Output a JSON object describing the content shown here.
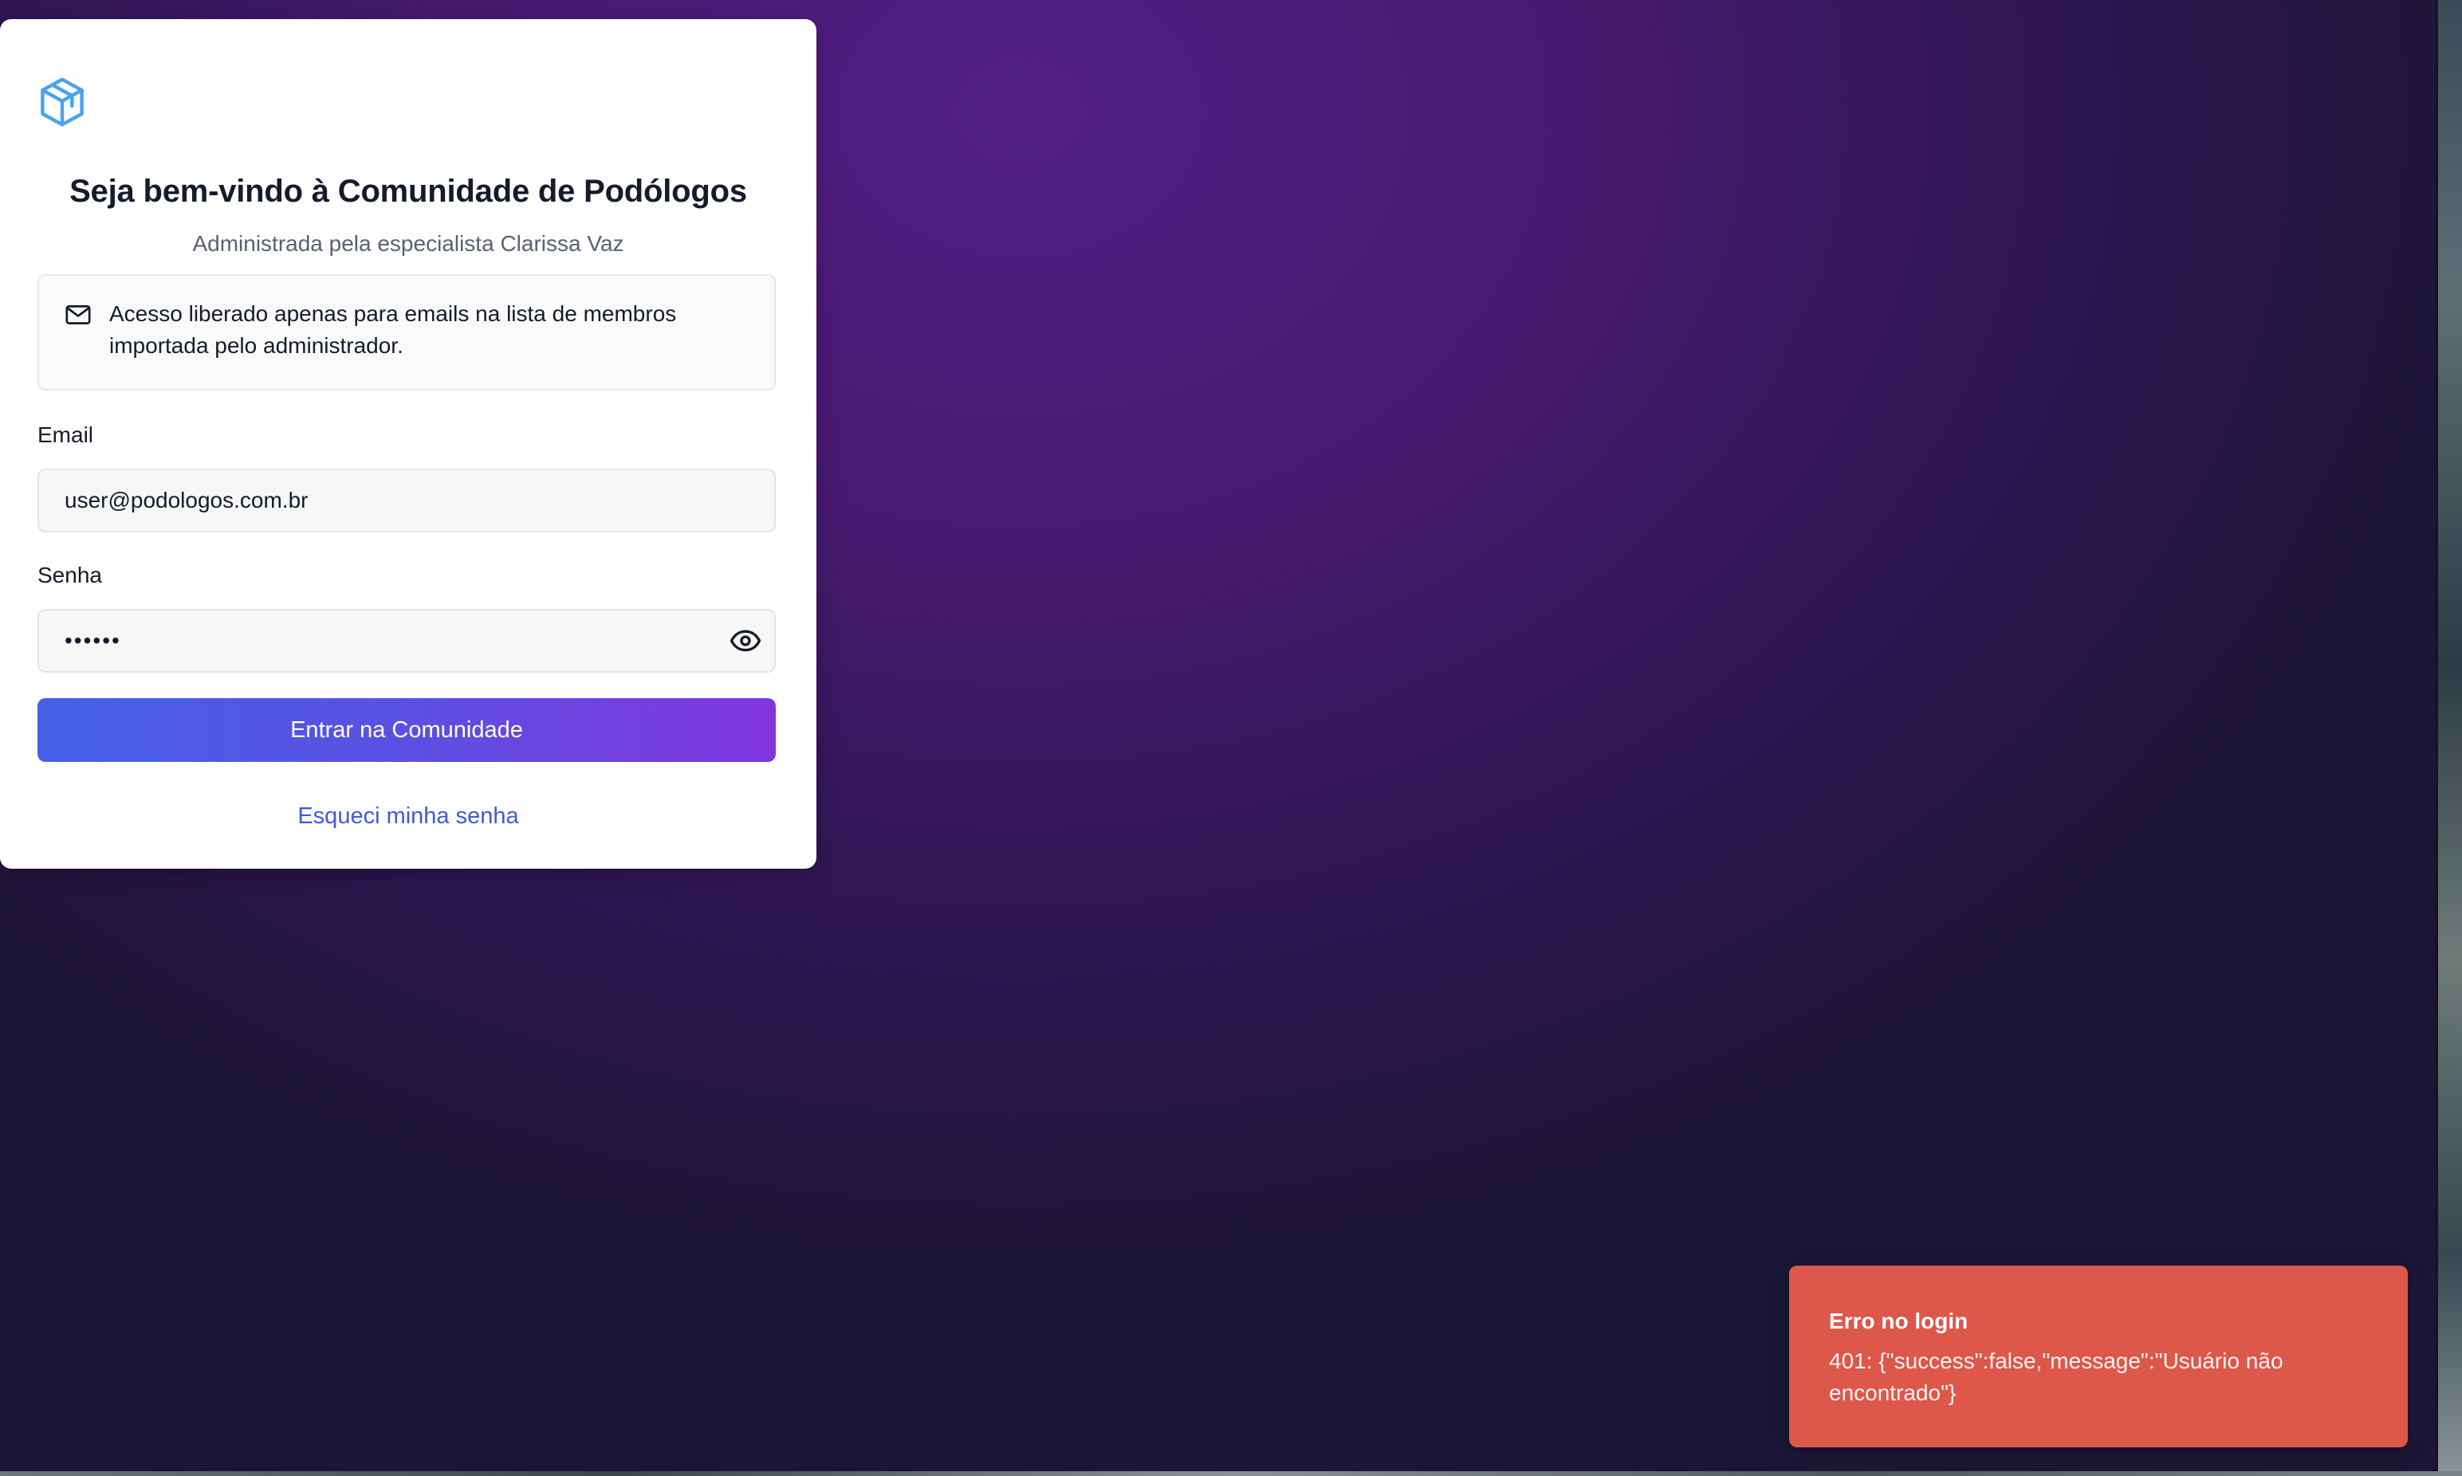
{
  "login": {
    "title": "Seja bem-vindo à Comunidade de Podólogos",
    "subtitle": "Administrada pela especialista Clarissa Vaz",
    "notice": "Acesso liberado apenas para emails na lista de membros importada pelo administrador.",
    "email_label": "Email",
    "email_value": "user@podologos.com.br",
    "password_label": "Senha",
    "password_value": "••••••",
    "submit_label": "Entrar na Comunidade",
    "forgot_label": "Esqueci minha senha",
    "icons": {
      "logo": "cube-logo-icon",
      "notice": "mail-icon",
      "password_toggle": "eye-icon"
    }
  },
  "toast": {
    "title": "Erro no login",
    "message": "401: {\"success\":false,\"message\":\"Usuário não encontrado\"}"
  },
  "colors": {
    "accent_start": "#4460e6",
    "accent_end": "#8135dc",
    "link": "#3b5bdb",
    "error": "#de574b",
    "background": "#47196f"
  }
}
